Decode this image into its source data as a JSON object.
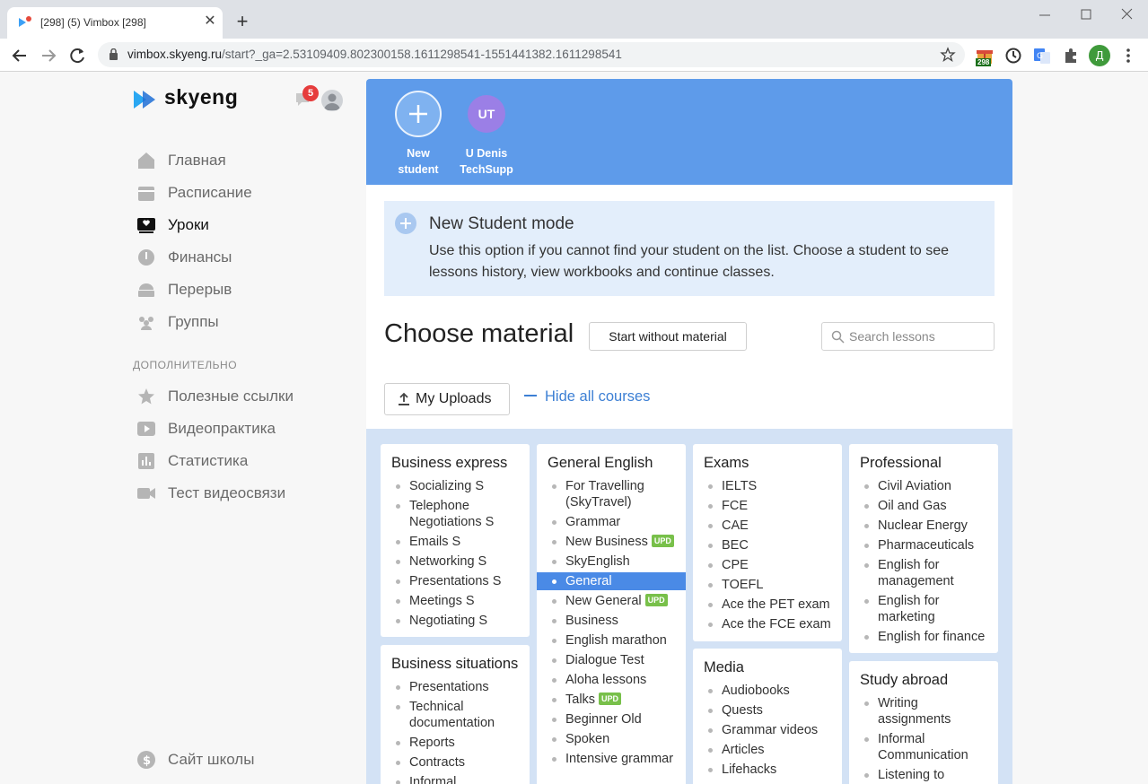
{
  "browser": {
    "tab_title": "[298] (5) Vimbox [298]",
    "url_host": "vimbox.skyeng.ru",
    "url_path": "/start?_ga=2.53109409.802300158.1611298541-1551441382.1611298541",
    "ext_badge": "298",
    "profile_letter": "Д"
  },
  "sidebar": {
    "logo": "skyeng",
    "chat_count": "5",
    "items": [
      {
        "label": "Главная",
        "icon": "home-icon"
      },
      {
        "label": "Расписание",
        "icon": "calendar-icon"
      },
      {
        "label": "Уроки",
        "icon": "lessons-icon",
        "active": true
      },
      {
        "label": "Финансы",
        "icon": "finance-icon"
      },
      {
        "label": "Перерыв",
        "icon": "break-icon"
      },
      {
        "label": "Группы",
        "icon": "groups-icon"
      }
    ],
    "section_label": "ДОПОЛНИТЕЛЬНО",
    "extra_items": [
      {
        "label": "Полезные ссылки",
        "icon": "star-icon"
      },
      {
        "label": "Видеопрактика",
        "icon": "video-icon"
      },
      {
        "label": "Статистика",
        "icon": "stats-icon"
      },
      {
        "label": "Тест видеосвязи",
        "icon": "camera-icon"
      }
    ],
    "school_site": "Сайт школы"
  },
  "students": [
    {
      "initials": "",
      "name_line1": "New",
      "name_line2": "student"
    },
    {
      "initials": "UT",
      "name_line1": "U Denis",
      "name_line2": "TechSupp"
    }
  ],
  "info": {
    "title": "New Student mode",
    "text": "Use this option if you cannot find your student on the list. Choose a student to see lessons history, view workbooks and continue classes."
  },
  "materials": {
    "title": "Choose material",
    "start_button": "Start without material",
    "search_placeholder": "Search lessons",
    "uploads_button": "My Uploads",
    "hide_courses": "Hide all courses"
  },
  "courses": {
    "business_express": {
      "title": "Business express",
      "items": [
        "Socializing S",
        "Telephone Negotiations S",
        "Emails S",
        "Networking S",
        "Presentations S",
        "Meetings S",
        "Negotiating S"
      ]
    },
    "business_situations": {
      "title": "Business situations",
      "items": [
        "Presentations",
        "Technical documentation",
        "Reports",
        "Contracts",
        "Informal"
      ]
    },
    "general_english": {
      "title": "General English",
      "items": [
        "For Travelling (SkyTravel)",
        "Grammar",
        "New Business",
        "SkyEnglish",
        "General",
        "New General",
        "Business",
        "English marathon",
        "Dialogue Test",
        "Aloha lessons",
        "Talks",
        "Beginner Old",
        "Spoken",
        "Intensive grammar"
      ]
    },
    "exams": {
      "title": "Exams",
      "items": [
        "IELTS",
        "FCE",
        "CAE",
        "BEC",
        "CPE",
        "TOEFL",
        "Ace the PET exam",
        "Ace the FCE exam"
      ]
    },
    "media": {
      "title": "Media",
      "items": [
        "Audiobooks",
        "Quests",
        "Grammar videos",
        "Articles",
        "Lifehacks"
      ]
    },
    "professional": {
      "title": "Professional",
      "items": [
        "Civil Aviation",
        "Oil and Gas",
        "Nuclear Energy",
        "Pharmaceuticals",
        "English for management",
        "English for marketing",
        "English for finance"
      ]
    },
    "study_abroad": {
      "title": "Study abroad",
      "items": [
        "Writing assignments",
        "Informal Communication",
        "Listening to"
      ]
    },
    "upd_badge": "UPD"
  },
  "colors": {
    "accent": "#5e9bea",
    "selected": "#4a8ae6",
    "upd": "#78c04a",
    "badge": "#e63c3c"
  }
}
